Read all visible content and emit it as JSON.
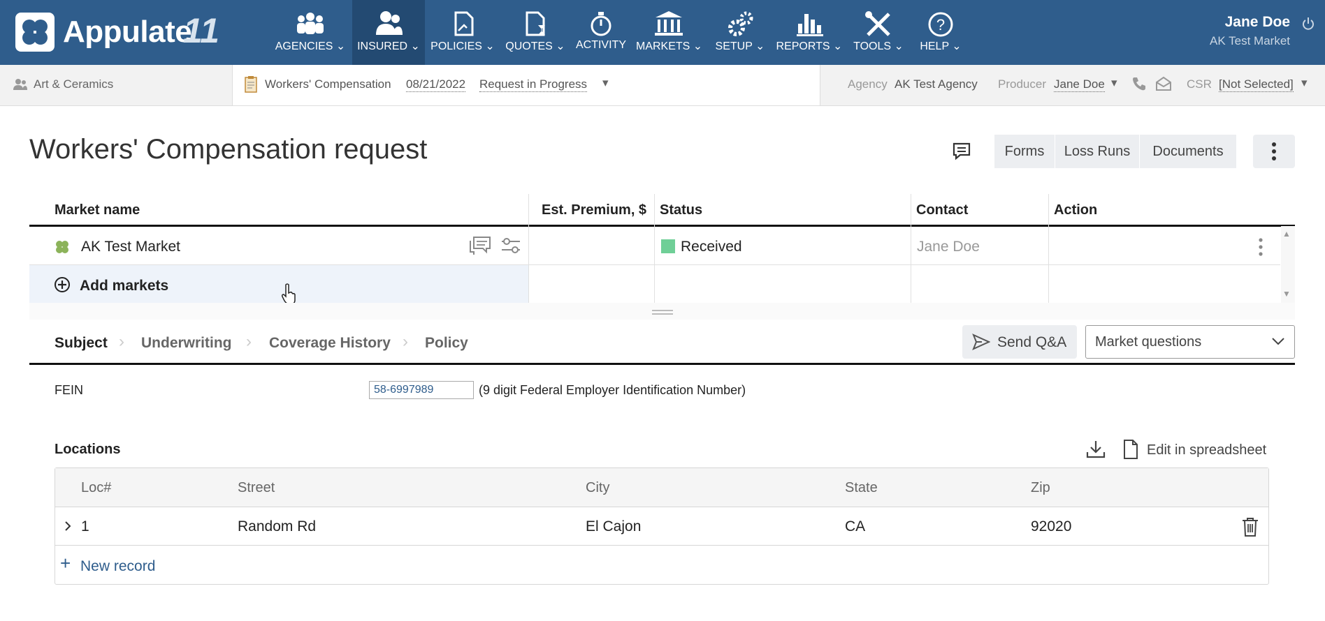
{
  "app": {
    "logo_text": "Appulate",
    "version_mark": "11"
  },
  "nav": [
    {
      "label": "AGENCIES",
      "icon": "people-group-icon"
    },
    {
      "label": "INSURED",
      "icon": "insured-people-icon",
      "active": true
    },
    {
      "label": "POLICIES",
      "icon": "policy-document-icon"
    },
    {
      "label": "QUOTES",
      "icon": "quote-document-hourglass-icon"
    },
    {
      "label": "ACTIVITY",
      "icon": "stopwatch-icon"
    },
    {
      "label": "MARKETS",
      "icon": "bank-building-icon"
    },
    {
      "label": "SETUP",
      "icon": "gears-icon"
    },
    {
      "label": "REPORTS",
      "icon": "bar-chart-icon"
    },
    {
      "label": "TOOLS",
      "icon": "wrench-screwdriver-icon"
    },
    {
      "label": "HELP",
      "icon": "help-circle-icon"
    }
  ],
  "user": {
    "name": "Jane Doe",
    "market": "AK Test Market"
  },
  "subbar": {
    "insured_name": "Art & Ceramics",
    "policy_type": "Workers' Compensation",
    "date": "08/21/2022",
    "status": "Request in Progress",
    "agency_label": "Agency",
    "agency_value": "AK Test Agency",
    "producer_label": "Producer",
    "producer_value": "Jane Doe",
    "csr_label": "CSR",
    "csr_value": "[Not Selected]"
  },
  "page": {
    "title": "Workers' Compensation request",
    "buttons": {
      "forms": "Forms",
      "loss_runs": "Loss Runs",
      "documents": "Documents"
    }
  },
  "markets_table": {
    "headers": {
      "market_name": "Market name",
      "est_premium": "Est. Premium, $",
      "status": "Status",
      "contact": "Contact",
      "action": "Action"
    },
    "rows": [
      {
        "market_name": "AK Test Market",
        "est_premium": "",
        "status": "Received",
        "status_color": "#6fcf97",
        "contact": "Jane Doe"
      }
    ],
    "add_markets": "Add markets"
  },
  "tabs": {
    "items": [
      "Subject",
      "Underwriting",
      "Coverage History",
      "Policy"
    ],
    "active": "Subject",
    "send_qa": "Send Q&A",
    "market_questions": "Market questions"
  },
  "fein": {
    "label": "FEIN",
    "value": "58-6997989",
    "hint": "(9 digit Federal Employer Identification Number)"
  },
  "locations": {
    "title": "Locations",
    "edit_spreadsheet": "Edit in spreadsheet",
    "headers": {
      "loc": "Loc#",
      "street": "Street",
      "city": "City",
      "state": "State",
      "zip": "Zip"
    },
    "rows": [
      {
        "loc": "1",
        "street": "Random Rd",
        "city": "El Cajon",
        "state": "CA",
        "zip": "92020"
      }
    ],
    "new_record": "New record"
  },
  "colors": {
    "nav_bg": "#2f5d8c",
    "nav_active": "#234a72",
    "link_blue": "#2f5d8c",
    "received_green": "#6fcf97"
  }
}
